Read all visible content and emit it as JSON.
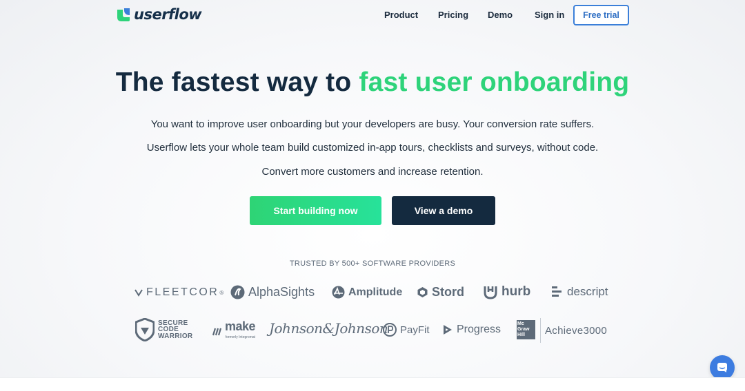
{
  "header": {
    "logo_text": "userflow",
    "nav": {
      "product": "Product",
      "pricing": "Pricing",
      "demo": "Demo",
      "sign_in": "Sign in",
      "free_trial": "Free trial"
    }
  },
  "hero": {
    "title_start": "The fastest way to ",
    "title_accent": "fast user onboarding",
    "subtitle_lines": [
      "You want to improve user onboarding but your developers are busy. Your conversion rate suffers.",
      "Userflow lets your whole team build customized in-app tours, checklists and surveys, without code.",
      "Convert more customers and increase retention."
    ],
    "primary_button": "Start building now",
    "secondary_button": "View a demo"
  },
  "trusted": {
    "label": "TRUSTED BY 500+ SOFTWARE PROVIDERS",
    "logos": {
      "fleetcor": "FLEETCOR",
      "fleetcor_mark": "®",
      "alphasights": "AlphaSights",
      "amplitude": "Amplitude",
      "stord": "Stord",
      "hurb": "hurb",
      "descript": "descript",
      "scw": [
        "SECURE",
        "CODE",
        "WARRIOR"
      ],
      "make": "make",
      "make_sub": "formerly Integromat",
      "johnson": "Johnson&Johnson",
      "payfit": "PayFit",
      "progress": "Progress",
      "mgh": [
        "Mc",
        "Graw",
        "Hill"
      ],
      "achieve": "Achieve3000"
    }
  },
  "colors": {
    "accent_green": "#2ed37a",
    "navy": "#142a3f",
    "blue": "#3b7fd9"
  },
  "icons": {
    "logo": "userflow-logo-icon",
    "chat": "chat-bubble-icon"
  }
}
